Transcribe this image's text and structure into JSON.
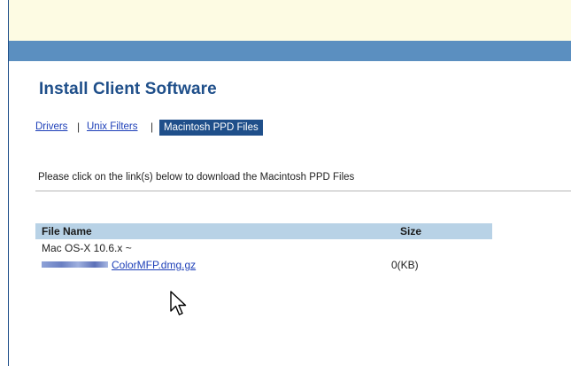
{
  "header": {
    "top_band_color": "#fdfbe3",
    "bar_color": "#5b8fc0"
  },
  "page": {
    "title": "Install Client Software"
  },
  "tabs": [
    {
      "label": "Drivers",
      "active": false
    },
    {
      "label": "Unix Filters",
      "active": false
    },
    {
      "label": "Macintosh PPD Files",
      "active": true
    }
  ],
  "tab_separator": "|",
  "instruction": "Please click on the link(s) below to download the Macintosh PPD Files",
  "file_table": {
    "headers": {
      "name": "File Name",
      "size": "Size"
    },
    "group_label": "Mac OS-X 10.6.x ~",
    "files": [
      {
        "name": "ColorMFP.dmg.gz",
        "name_prefix_redacted": true,
        "size": "0(KB)"
      }
    ]
  },
  "icons": {
    "cursor": "arrow-cursor-icon"
  }
}
